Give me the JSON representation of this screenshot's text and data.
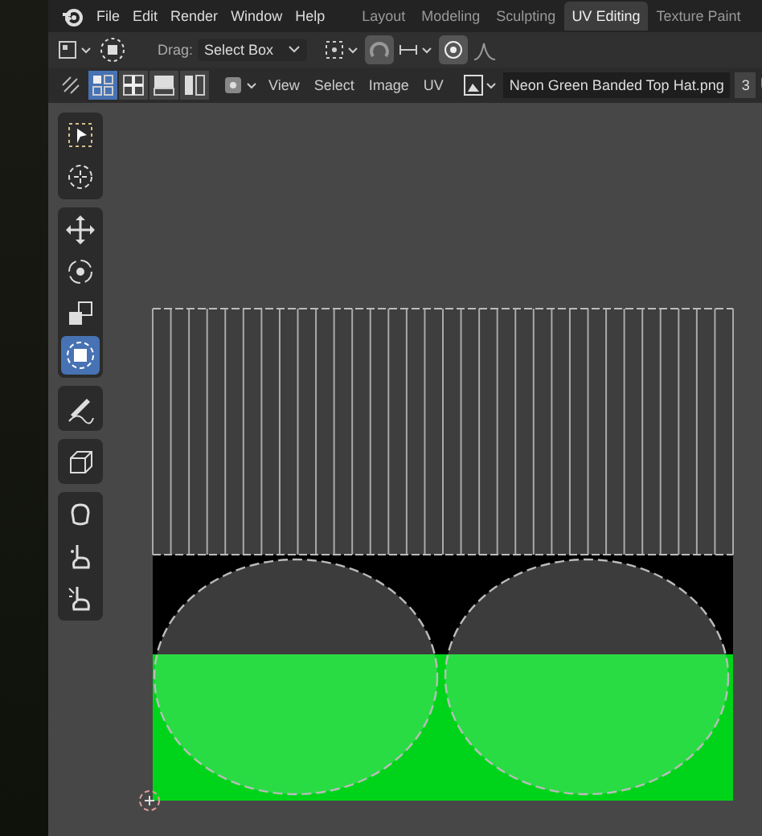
{
  "menus": [
    {
      "label": "File"
    },
    {
      "label": "Edit"
    },
    {
      "label": "Render"
    },
    {
      "label": "Window"
    },
    {
      "label": "Help"
    }
  ],
  "workspaces": [
    {
      "label": "Layout",
      "selected": false
    },
    {
      "label": "Modeling",
      "selected": false
    },
    {
      "label": "Sculpting",
      "selected": false
    },
    {
      "label": "UV Editing",
      "selected": true
    },
    {
      "label": "Texture Paint",
      "selected": false
    }
  ],
  "tool_header": {
    "drag_label": "Drag:",
    "drag_value": "Select Box"
  },
  "select_modes": [
    {
      "selected": true
    },
    {
      "selected": false
    },
    {
      "selected": false
    },
    {
      "selected": false
    }
  ],
  "editor_menus": [
    {
      "label": "View"
    },
    {
      "label": "Select"
    },
    {
      "label": "Image"
    },
    {
      "label": "UV"
    }
  ],
  "image": {
    "name": "Neon Green Banded Top Hat.png",
    "users": "3"
  },
  "tool_groups": [
    {
      "tools": [
        {
          "selected": false
        },
        {
          "selected": false
        }
      ]
    },
    {
      "tools": [
        {
          "selected": false
        },
        {
          "selected": false
        },
        {
          "selected": false
        },
        {
          "selected": true
        }
      ]
    },
    {
      "tools": [
        {
          "selected": false
        }
      ]
    },
    {
      "tools": [
        {
          "selected": false
        }
      ]
    },
    {
      "tools": [
        {
          "selected": false
        },
        {
          "selected": false
        },
        {
          "selected": false
        }
      ]
    }
  ]
}
